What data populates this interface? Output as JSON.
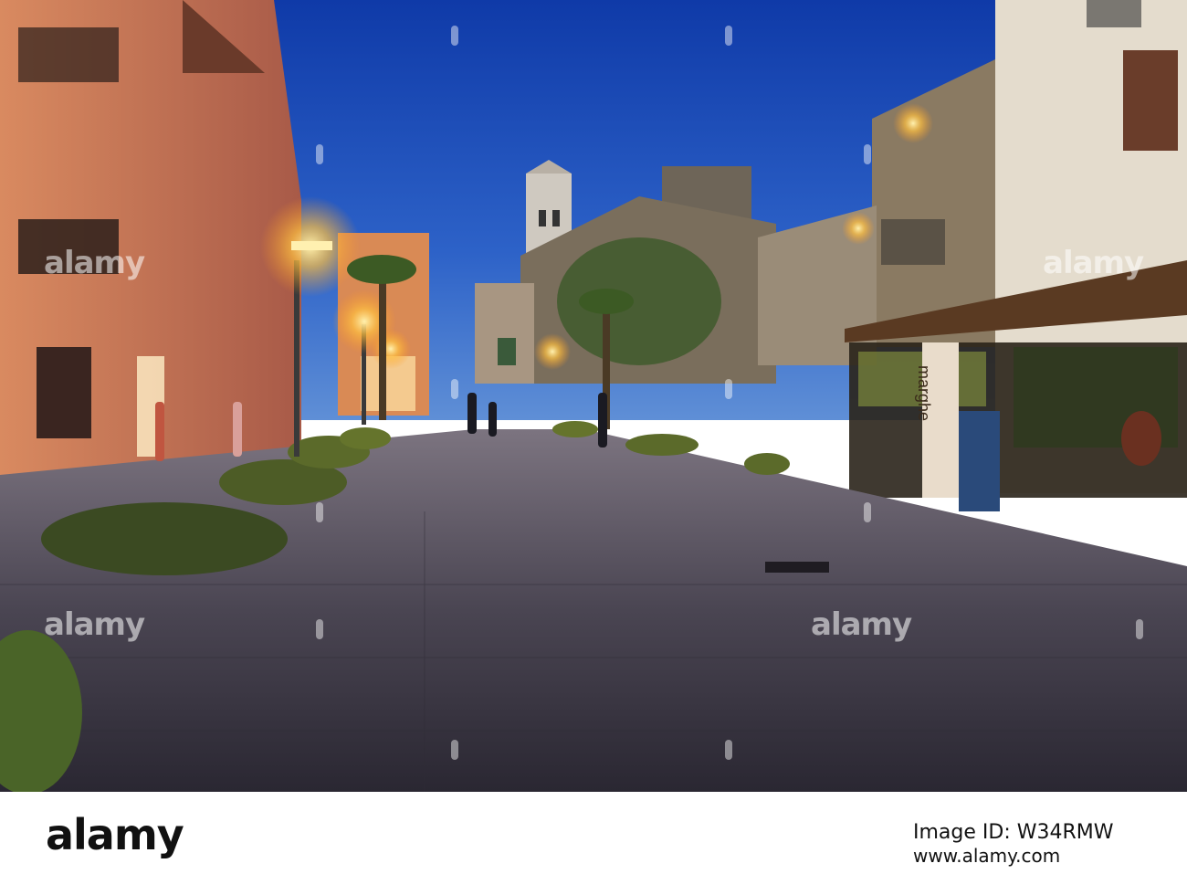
{
  "watermark": {
    "text": "alamy"
  },
  "storefront": {
    "sign_text": "marghe"
  },
  "footer": {
    "logo": "alamy",
    "image_id": "Image ID: W34RMW",
    "url": "www.alamy.com"
  },
  "colors": {
    "sky": "#1f4fb8",
    "lamp_glow": "#ffcf66",
    "pavement": "#3d3a44",
    "building_left": "#c87a5a"
  }
}
